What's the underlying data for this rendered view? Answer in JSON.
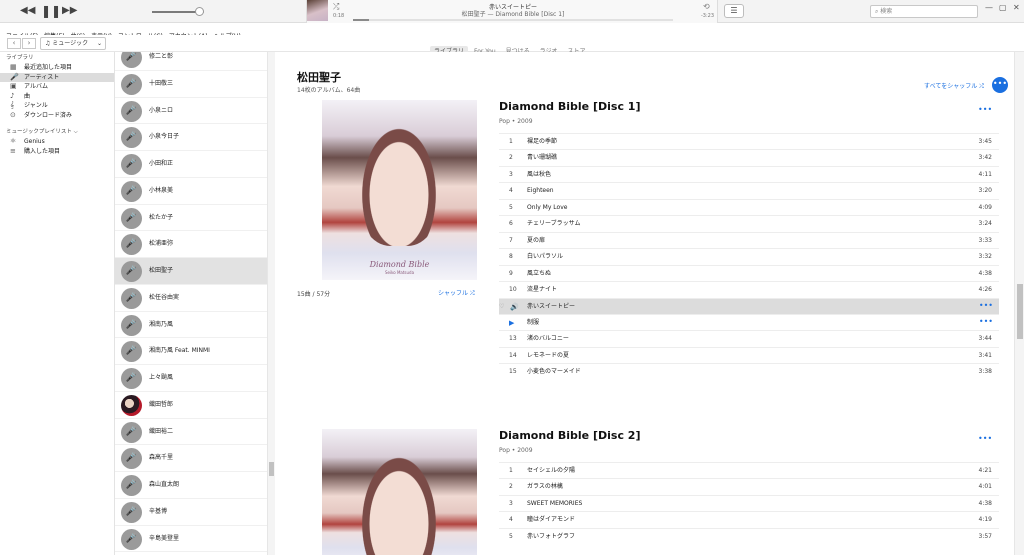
{
  "player": {
    "prev_icon": "rewind-icon",
    "pause_icon": "pause-icon",
    "next_icon": "fast-forward-icon",
    "volume_fraction": 0.9,
    "now_playing_title": "赤いスイートピー",
    "now_playing_subtitle": "松田聖子 — Diamond Bible [Disc 1]",
    "elapsed": "0:18",
    "remaining": "-3:23",
    "progress_fraction": 0.05,
    "search_placeholder": "検索"
  },
  "menu": [
    "ファイル(F)",
    "編集(E)",
    "曲(S)",
    "表示(V)",
    "コントロール(C)",
    "アカウント(A)",
    "ヘルプ(H)"
  ],
  "nav": {
    "media_selector": "ミュージック",
    "tabs": [
      "ライブラリ",
      "For You",
      "見つける",
      "ラジオ",
      "ストア"
    ],
    "active_tab": "ライブラリ"
  },
  "sidebar": {
    "library_heading": "ライブラリ",
    "library_items": [
      {
        "label": "最近追加した項目",
        "icon": "calendar-icon"
      },
      {
        "label": "アーティスト",
        "icon": "microphone-icon"
      },
      {
        "label": "アルバム",
        "icon": "album-icon"
      },
      {
        "label": "曲",
        "icon": "music-note-icon"
      },
      {
        "label": "ジャンル",
        "icon": "genre-icon"
      },
      {
        "label": "ダウンロード済み",
        "icon": "download-icon"
      }
    ],
    "playlists_heading": "ミュージックプレイリスト ⌵",
    "playlist_items": [
      {
        "label": "Genius",
        "icon": "genius-icon"
      },
      {
        "label": "購入した項目",
        "icon": "purchased-list-icon"
      }
    ]
  },
  "artists": [
    "修二と彰",
    "十田敬三",
    "小泉ニロ",
    "小泉今日子",
    "小田和正",
    "小林泉美",
    "松たか子",
    "松浦亜弥",
    "松田聖子",
    "松任谷由実",
    "湘南乃風",
    "湘南乃風 Feat. MINMI",
    "上々颱風",
    "織田哲郎",
    "織田裕二",
    "森高千里",
    "森山直太朗",
    "辛基博",
    "辛島美登里"
  ],
  "selected_artist": "松田聖子",
  "artist_header": {
    "name": "松田聖子",
    "summary": "14枚のアルバム、64曲",
    "shuffle_all": "すべてをシャッフル",
    "more": "•••"
  },
  "albums": [
    {
      "title": "Diamond Bible [Disc 1]",
      "genre_year": "Pop • 2009",
      "cover_text": "Diamond Bible",
      "cover_subtext": "Seiko Matsuda",
      "meta": "15曲 / 57分",
      "shuffle": "シャッフル",
      "more": "•••",
      "tracks": [
        {
          "n": "1",
          "title": "裸足の季節",
          "dur": "3:45"
        },
        {
          "n": "2",
          "title": "青い珊瑚礁",
          "dur": "3:42"
        },
        {
          "n": "3",
          "title": "風は秋色",
          "dur": "4:11"
        },
        {
          "n": "4",
          "title": "Eighteen",
          "dur": "3:20"
        },
        {
          "n": "5",
          "title": "Only My Love",
          "dur": "4:09"
        },
        {
          "n": "6",
          "title": "チェリーブラッサム",
          "dur": "3:24"
        },
        {
          "n": "7",
          "title": "夏の扉",
          "dur": "3:33"
        },
        {
          "n": "8",
          "title": "白いパラソル",
          "dur": "3:32"
        },
        {
          "n": "9",
          "title": "風立ちぬ",
          "dur": "4:38"
        },
        {
          "n": "10",
          "title": "流星ナイト",
          "dur": "4:26"
        },
        {
          "n": "",
          "title": "赤いスイートピー",
          "dur": "•••",
          "state": "playing"
        },
        {
          "n": "",
          "title": "制服",
          "dur": "•••",
          "state": "queued"
        },
        {
          "n": "13",
          "title": "渚のバルコニー",
          "dur": "3:44"
        },
        {
          "n": "14",
          "title": "レモネードの夏",
          "dur": "3:41"
        },
        {
          "n": "15",
          "title": "小麦色のマーメイド",
          "dur": "3:38"
        }
      ]
    },
    {
      "title": "Diamond Bible [Disc 2]",
      "genre_year": "Pop • 2009",
      "more": "•••",
      "tracks": [
        {
          "n": "1",
          "title": "セイシェルの夕陽",
          "dur": "4:21"
        },
        {
          "n": "2",
          "title": "ガラスの林檎",
          "dur": "4:01"
        },
        {
          "n": "3",
          "title": "SWEET MEMORIES",
          "dur": "4:38"
        },
        {
          "n": "4",
          "title": "瞳はダイアモンド",
          "dur": "4:19"
        },
        {
          "n": "5",
          "title": "赤いフォトグラフ",
          "dur": "3:57"
        }
      ]
    }
  ]
}
